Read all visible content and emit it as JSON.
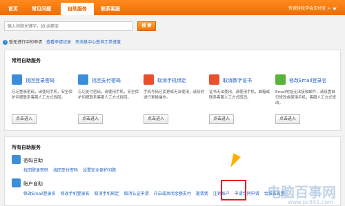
{
  "header": {
    "tabs": [
      {
        "label": "首页"
      },
      {
        "label": "常见问题"
      },
      {
        "label": "自助服务"
      },
      {
        "label": "联系客服"
      }
    ],
    "quick_link": "快速轻松学会支付宝 >"
  },
  "search": {
    "placeholder": "输入问题关键字，如:余额宝",
    "button": "搜 索"
  },
  "notice": {
    "text": "暂无进行中的申请",
    "link1": "查看申请记录",
    "link2": "去消息中心查询工单进度"
  },
  "common": {
    "title": "常用自助服务",
    "cards": [
      {
        "title": "找回登录密码",
        "desc": "忘记登录密码，请使用手机，安全保护问题联系客服人工方式找回。",
        "button": "点击进入"
      },
      {
        "title": "找回支付密码",
        "desc": "忘记支付密码，请使用手机，安全保护问题联系客服人工方式找回。",
        "button": "点击进入"
      },
      {
        "title": "取消手机绑定",
        "desc": "手机号码已变更或无法使用，请及时进行更换操作。",
        "button": "点击进入"
      },
      {
        "title": "取消数字证书",
        "desc": "证书无法使用，请使用手机，邮箱或联系客服人工方式取消。",
        "button": "点击进入"
      },
      {
        "title": "修改Email登录名",
        "desc": "Email地址无法接收邮件，请设置自行修改或使用手机，客服人工方式修改。",
        "button": "点击进入"
      }
    ]
  },
  "all": {
    "title": "所有自助服务",
    "sections": [
      {
        "title": "密码自助",
        "links": [
          "找回登录密码",
          "找回支付密码",
          "设置安全保护问题"
        ]
      },
      {
        "title": "账户自助",
        "links": [
          "修改Email登录名",
          "修改手机登录名",
          "取消手机绑定",
          "取消认证申请",
          "开启或关闭余额支付",
          "邀请我",
          "注销账户",
          "申请合同申请",
          "会员名设置"
        ]
      }
    ]
  },
  "watermark": {
    "text": "电脑百事网",
    "url": "www.pc841.com"
  }
}
